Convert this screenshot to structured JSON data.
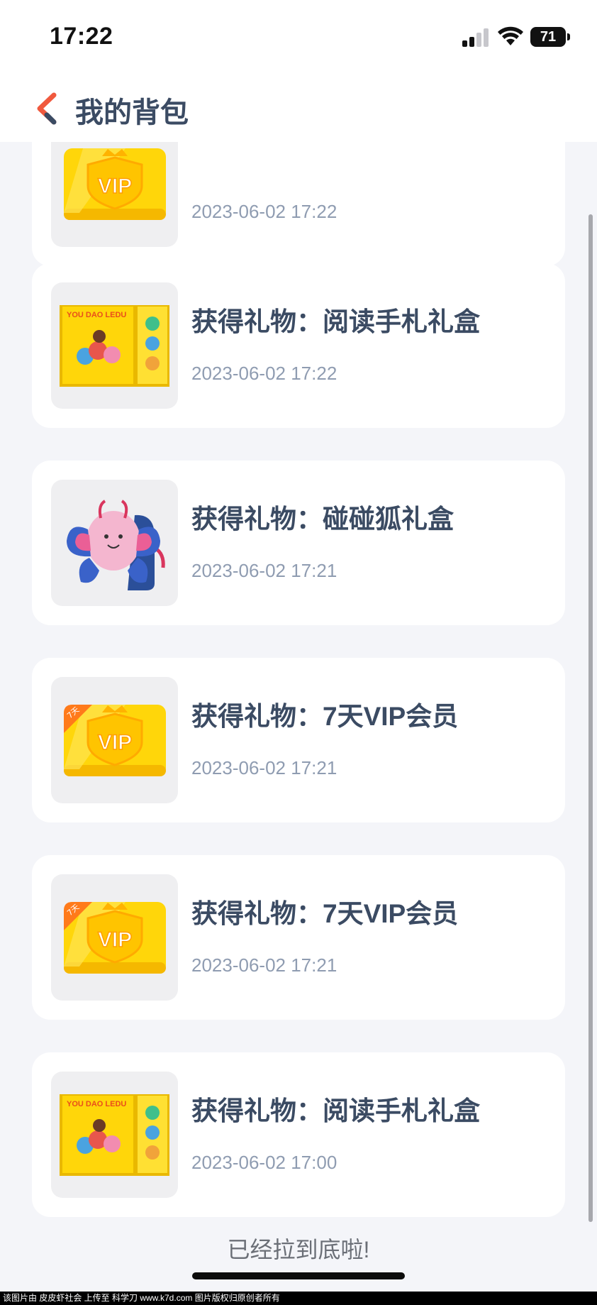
{
  "status_bar": {
    "time": "17:22",
    "battery": "71"
  },
  "header": {
    "title": "我的背包"
  },
  "items": [
    {
      "title": "",
      "time": "2023-06-02 17:22",
      "thumb": "vip-card"
    },
    {
      "title": "获得礼物：阅读手札礼盒",
      "time": "2023-06-02 17:22",
      "thumb": "reading-box"
    },
    {
      "title": "获得礼物：碰碰狐礼盒",
      "time": "2023-06-02 17:21",
      "thumb": "butterfly-backpack"
    },
    {
      "title": "获得礼物：7天VIP会员",
      "time": "2023-06-02 17:21",
      "thumb": "vip-card"
    },
    {
      "title": "获得礼物：7天VIP会员",
      "time": "2023-06-02 17:21",
      "thumb": "vip-card"
    },
    {
      "title": "获得礼物：阅读手札礼盒",
      "time": "2023-06-02 17:00",
      "thumb": "reading-box"
    }
  ],
  "thumb_text": {
    "vip": "VIP",
    "vip_badge": "7天",
    "box_brand": "YOU DAO LEDU"
  },
  "footer": {
    "end_text": "已经拉到底啦!"
  },
  "watermark": "该图片由 皮皮虾社会 上传至 科学刀 www.k7d.com 图片版权归原创者所有",
  "colors": {
    "accent_back": "#f0593e",
    "title": "#3b4b63",
    "time": "#8f9cb1",
    "card_bg": "#ffffff",
    "page_bg": "#f4f5f9"
  }
}
